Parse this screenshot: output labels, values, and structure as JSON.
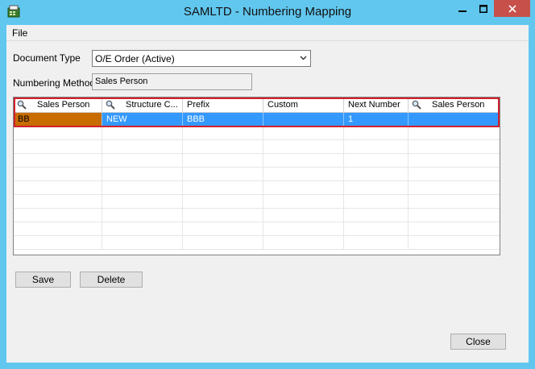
{
  "window": {
    "title": "SAMLTD - Numbering Mapping",
    "colors": {
      "frame": "#61c7ef",
      "close_button": "#c7504b",
      "selection": "#3399ff",
      "editing_cell": "#c86c00",
      "highlight_box": "#d1202c"
    }
  },
  "menu": {
    "file": "File"
  },
  "form": {
    "document_type_label": "Document Type",
    "document_type_value": "O/E Order (Active)",
    "numbering_method_label": "Numbering Method",
    "numbering_method_value": "Sales Person"
  },
  "grid": {
    "columns": [
      "Sales Person",
      "Structure C...",
      "Prefix",
      "Custom",
      "Next Number",
      "Sales Person"
    ],
    "rows": [
      [
        "BB",
        "NEW",
        "BBB",
        "",
        "1",
        ""
      ]
    ]
  },
  "buttons": {
    "save": "Save",
    "delete": "Delete",
    "close": "Close"
  }
}
